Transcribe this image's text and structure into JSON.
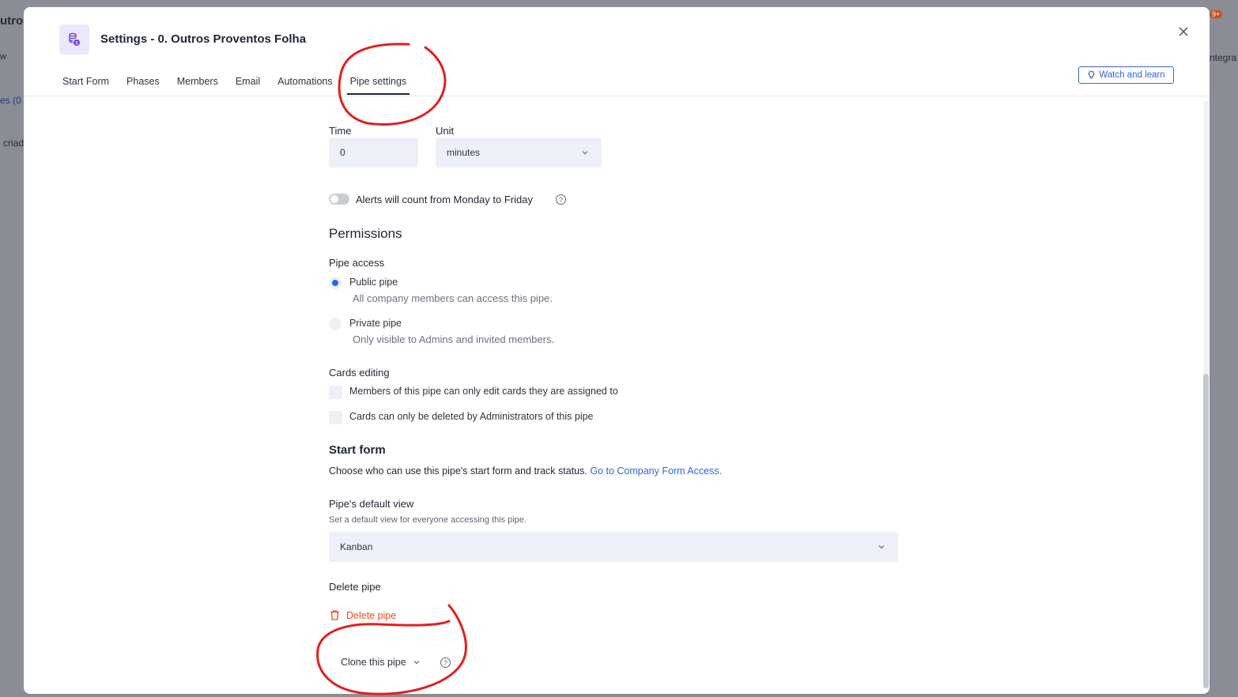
{
  "background": {
    "left_title_fragment": "utro",
    "left_nav_fragment": "w",
    "left_count_fragment": "es (0",
    "left_note_fragment": "criad",
    "right_tab_fragment": "ntegra",
    "badge": "9+"
  },
  "header": {
    "title": "Settings - 0. Outros Proventos Folha",
    "pipe_icon": "coins-icon",
    "close_icon": "close-icon",
    "tabs": [
      {
        "label": "Start Form",
        "active": false
      },
      {
        "label": "Phases",
        "active": false
      },
      {
        "label": "Members",
        "active": false
      },
      {
        "label": "Email",
        "active": false
      },
      {
        "label": "Automations",
        "active": false
      },
      {
        "label": "Pipe settings",
        "active": true
      }
    ],
    "watch_button": {
      "label": "Watch and learn",
      "icon": "lightbulb-icon"
    }
  },
  "alerts": {
    "time_label": "Time",
    "time_value": "0",
    "unit_label": "Unit",
    "unit_value": "minutes",
    "weekday_toggle_label": "Alerts will count from Monday to Friday",
    "weekday_toggle_on": false
  },
  "permissions": {
    "heading": "Permissions",
    "pipe_access": {
      "label": "Pipe access",
      "options": [
        {
          "label": "Public pipe",
          "description": "All company members can access this pipe.",
          "selected": true
        },
        {
          "label": "Private pipe",
          "description": "Only visible to Admins and invited members.",
          "selected": false
        }
      ]
    },
    "cards_editing": {
      "label": "Cards editing",
      "options": [
        {
          "label": "Members of this pipe can only edit cards they are assigned to",
          "checked": false
        },
        {
          "label": "Cards can only be deleted by Administrators of this pipe",
          "checked": false
        }
      ]
    }
  },
  "start_form": {
    "heading": "Start form",
    "description": "Choose who can use this pipe's start form and track status.",
    "link": "Go to Company Form Access."
  },
  "default_view": {
    "label": "Pipe's default view",
    "description": "Set a default view for everyone accessing this pipe.",
    "value": "Kanban"
  },
  "delete": {
    "label": "Delete pipe",
    "button": "Delete pipe",
    "icon": "trash-icon"
  },
  "clone": {
    "label": "Clone this pipe"
  },
  "colors": {
    "accent": "#2f67d5",
    "danger": "#e8471d",
    "annotation": "#e02020",
    "field_bg": "#eef0f8"
  }
}
